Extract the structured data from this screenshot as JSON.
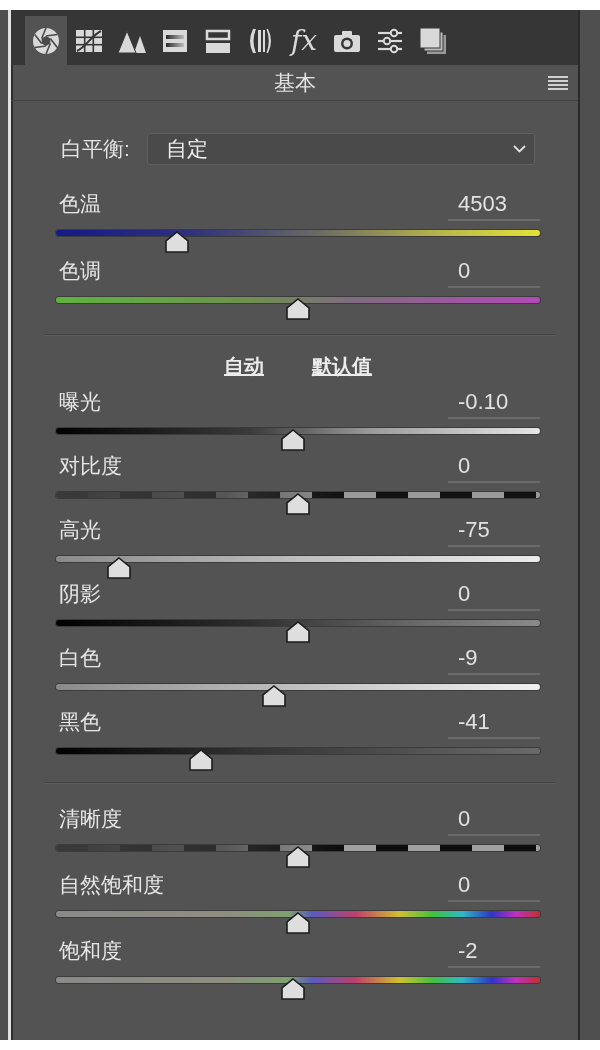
{
  "tabs": [
    {
      "selected": true
    },
    {
      "selected": false
    },
    {
      "selected": false
    },
    {
      "selected": false
    },
    {
      "selected": false
    },
    {
      "selected": false
    },
    {
      "selected": false,
      "label": "fx"
    },
    {
      "selected": false
    },
    {
      "selected": false
    },
    {
      "selected": false
    }
  ],
  "panel": {
    "title": "基本"
  },
  "white_balance": {
    "label": "白平衡:",
    "value": "自定"
  },
  "color_sliders": [
    {
      "kind": "temperature",
      "label": "色温",
      "value": "4503",
      "level": 0.25
    },
    {
      "kind": "tint",
      "label": "色调",
      "value": "0",
      "level": 0.5
    }
  ],
  "actions": [
    "自动",
    "默认值"
  ],
  "tone_sliders": [
    {
      "kind": "exposure",
      "label": "曝光",
      "value": "-0.10",
      "level": 0.49
    },
    {
      "kind": "contrast",
      "label": "对比度",
      "value": "0",
      "level": 0.5
    },
    {
      "kind": "highlights",
      "label": "高光",
      "value": "-75",
      "level": 0.13
    },
    {
      "kind": "shadows",
      "label": "阴影",
      "value": "0",
      "level": 0.5
    },
    {
      "kind": "whites",
      "label": "白色",
      "value": "-9",
      "level": 0.45
    },
    {
      "kind": "blacks",
      "label": "黑色",
      "value": "-41",
      "level": 0.3
    }
  ],
  "presence_sliders": [
    {
      "kind": "clarity",
      "label": "清晰度",
      "value": "0",
      "level": 0.5
    },
    {
      "kind": "vibrance",
      "label": "自然饱和度",
      "value": "0",
      "level": 0.5
    },
    {
      "kind": "saturation",
      "label": "饱和度",
      "value": "-2",
      "level": 0.49
    }
  ]
}
